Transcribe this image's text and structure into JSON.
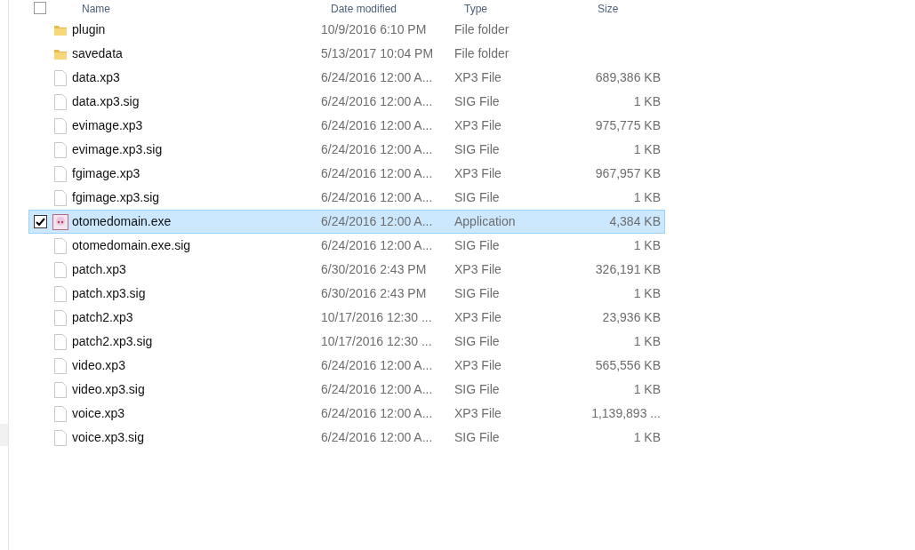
{
  "columns": [
    "Name",
    "Date modified",
    "Type",
    "Size"
  ],
  "select_all": {
    "checked": false
  },
  "rows": [
    {
      "kind": "folder",
      "name": "plugin",
      "date": "10/9/2016 6:10 PM",
      "type": "File folder",
      "size": "",
      "selected": false
    },
    {
      "kind": "folder",
      "name": "savedata",
      "date": "5/13/2017 10:04 PM",
      "type": "File folder",
      "size": "",
      "selected": false
    },
    {
      "kind": "file",
      "name": "data.xp3",
      "date": "6/24/2016 12:00 A...",
      "type": "XP3 File",
      "size": "689,386 KB",
      "selected": false
    },
    {
      "kind": "file",
      "name": "data.xp3.sig",
      "date": "6/24/2016 12:00 A...",
      "type": "SIG File",
      "size": "1 KB",
      "selected": false
    },
    {
      "kind": "file",
      "name": "evimage.xp3",
      "date": "6/24/2016 12:00 A...",
      "type": "XP3 File",
      "size": "975,775 KB",
      "selected": false
    },
    {
      "kind": "file",
      "name": "evimage.xp3.sig",
      "date": "6/24/2016 12:00 A...",
      "type": "SIG File",
      "size": "1 KB",
      "selected": false
    },
    {
      "kind": "file",
      "name": "fgimage.xp3",
      "date": "6/24/2016 12:00 A...",
      "type": "XP3 File",
      "size": "967,957 KB",
      "selected": false
    },
    {
      "kind": "file",
      "name": "fgimage.xp3.sig",
      "date": "6/24/2016 12:00 A...",
      "type": "SIG File",
      "size": "1 KB",
      "selected": false
    },
    {
      "kind": "app",
      "name": "otomedomain.exe",
      "date": "6/24/2016 12:00 A...",
      "type": "Application",
      "size": "4,384 KB",
      "selected": true
    },
    {
      "kind": "file",
      "name": "otomedomain.exe.sig",
      "date": "6/24/2016 12:00 A...",
      "type": "SIG File",
      "size": "1 KB",
      "selected": false
    },
    {
      "kind": "file",
      "name": "patch.xp3",
      "date": "6/30/2016 2:43 PM",
      "type": "XP3 File",
      "size": "326,191 KB",
      "selected": false
    },
    {
      "kind": "file",
      "name": "patch.xp3.sig",
      "date": "6/30/2016 2:43 PM",
      "type": "SIG File",
      "size": "1 KB",
      "selected": false
    },
    {
      "kind": "file",
      "name": "patch2.xp3",
      "date": "10/17/2016 12:30 ...",
      "type": "XP3 File",
      "size": "23,936 KB",
      "selected": false
    },
    {
      "kind": "file",
      "name": "patch2.xp3.sig",
      "date": "10/17/2016 12:30 ...",
      "type": "SIG File",
      "size": "1 KB",
      "selected": false
    },
    {
      "kind": "file",
      "name": "video.xp3",
      "date": "6/24/2016 12:00 A...",
      "type": "XP3 File",
      "size": "565,556 KB",
      "selected": false
    },
    {
      "kind": "file",
      "name": "video.xp3.sig",
      "date": "6/24/2016 12:00 A...",
      "type": "SIG File",
      "size": "1 KB",
      "selected": false
    },
    {
      "kind": "file",
      "name": "voice.xp3",
      "date": "6/24/2016 12:00 A...",
      "type": "XP3 File",
      "size": "1,139,893 ...",
      "selected": false
    },
    {
      "kind": "file",
      "name": "voice.xp3.sig",
      "date": "6/24/2016 12:00 A...",
      "type": "SIG File",
      "size": "1 KB",
      "selected": false
    }
  ]
}
